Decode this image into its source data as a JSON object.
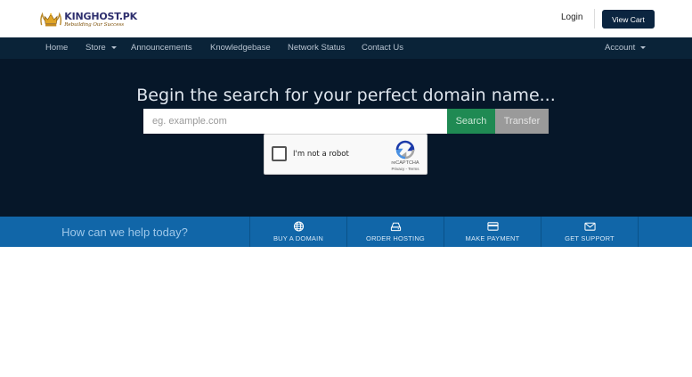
{
  "header": {
    "logo_name": "KINGHOST.PK",
    "logo_tagline": "Rebuilding Our Success",
    "login_label": "Login",
    "cart_label": "View Cart"
  },
  "nav": {
    "items": [
      {
        "label": "Home"
      },
      {
        "label": "Store"
      },
      {
        "label": "Announcements"
      },
      {
        "label": "Knowledgebase"
      },
      {
        "label": "Network Status"
      },
      {
        "label": "Contact Us"
      }
    ],
    "account_label": "Account"
  },
  "hero": {
    "title": "Begin the search for your perfect domain name...",
    "search_placeholder": "eg. example.com",
    "search_button": "Search",
    "transfer_button": "Transfer"
  },
  "recaptcha": {
    "label": "I'm not a robot",
    "brand": "reCAPTCHA",
    "links": "Privacy - Terms"
  },
  "help": {
    "prompt": "How can we help today?",
    "actions": [
      {
        "label": "BUY A DOMAIN",
        "icon": "globe-icon"
      },
      {
        "label": "ORDER HOSTING",
        "icon": "hdd-icon"
      },
      {
        "label": "MAKE PAYMENT",
        "icon": "credit-card-icon"
      },
      {
        "label": "GET SUPPORT",
        "icon": "envelope-icon"
      }
    ]
  },
  "colors": {
    "nav_bg": "#0a2338",
    "hero_bg": "#061729",
    "help_bg": "#1166a8",
    "search_btn": "#1f8a53",
    "transfer_btn": "#9a9a9a",
    "cart_btn": "#0b2540"
  }
}
